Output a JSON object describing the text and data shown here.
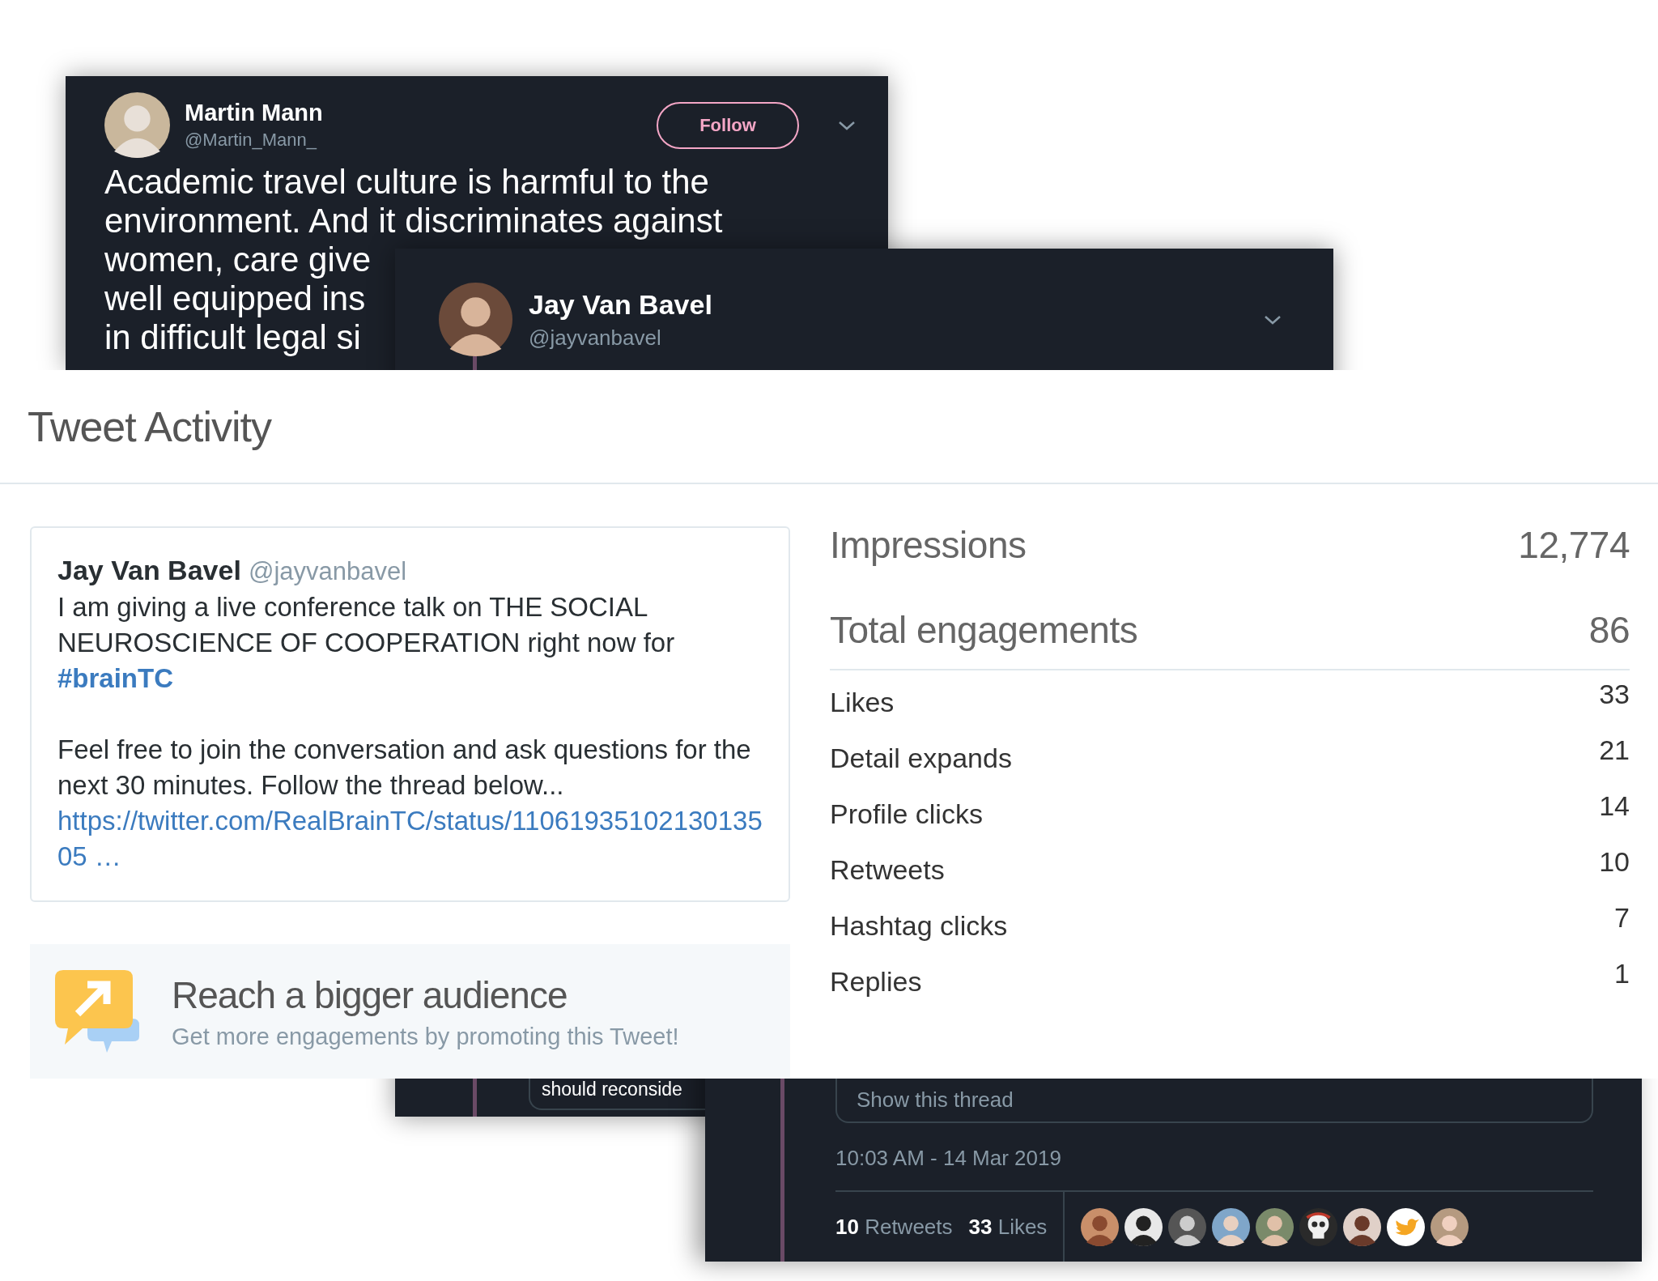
{
  "martin_tweet": {
    "name": "Martin Mann",
    "handle": "@Martin_Mann_",
    "follow_button": "Follow",
    "text_lines": [
      "Academic travel culture is harmful to the",
      "environment. And it discriminates against",
      "women, care give",
      "well equipped ins",
      "in difficult legal si"
    ]
  },
  "jay_tweet": {
    "name": "Jay Van Bavel",
    "handle": "@jayvanbavel",
    "quoted_fragment": "should reconside"
  },
  "thread_tweet": {
    "show_thread": "Show this thread",
    "timestamp": "10:03 AM - 14 Mar 2019",
    "retweets_count": "10",
    "retweets_label": "Retweets",
    "likes_count": "33",
    "likes_label": "Likes",
    "liker_avatars": [
      {
        "kind": "person"
      },
      {
        "kind": "person"
      },
      {
        "kind": "person"
      },
      {
        "kind": "person"
      },
      {
        "kind": "person"
      },
      {
        "kind": "skull"
      },
      {
        "kind": "person"
      },
      {
        "kind": "bird"
      },
      {
        "kind": "person"
      }
    ]
  },
  "tweet_activity": {
    "title": "Tweet Activity",
    "tweet": {
      "name": "Jay Van Bavel",
      "handle": "@jayvanbavel",
      "text": "I am giving a live conference talk on THE SOCIAL NEUROSCIENCE OF COOPERATION right now for",
      "hashtag": "#brainTC",
      "text_2": "Feel free to join the conversation and ask questions for the next 30 minutes. Follow the thread below...",
      "link": "https://twitter.com/RealBrainTC/status/1106193510213013505 …"
    },
    "promo": {
      "title": "Reach a bigger audience",
      "subtitle": "Get more engagements by promoting this Tweet!"
    },
    "impressions": {
      "label": "Impressions",
      "value": "12,774"
    },
    "total_engagements": {
      "label": "Total engagements",
      "value": "86"
    },
    "engagements": [
      {
        "label": "Likes",
        "value": "33"
      },
      {
        "label": "Detail expands",
        "value": "21"
      },
      {
        "label": "Profile clicks",
        "value": "14"
      },
      {
        "label": "Retweets",
        "value": "10"
      },
      {
        "label": "Hashtag clicks",
        "value": "7"
      },
      {
        "label": "Replies",
        "value": "1"
      }
    ]
  }
}
